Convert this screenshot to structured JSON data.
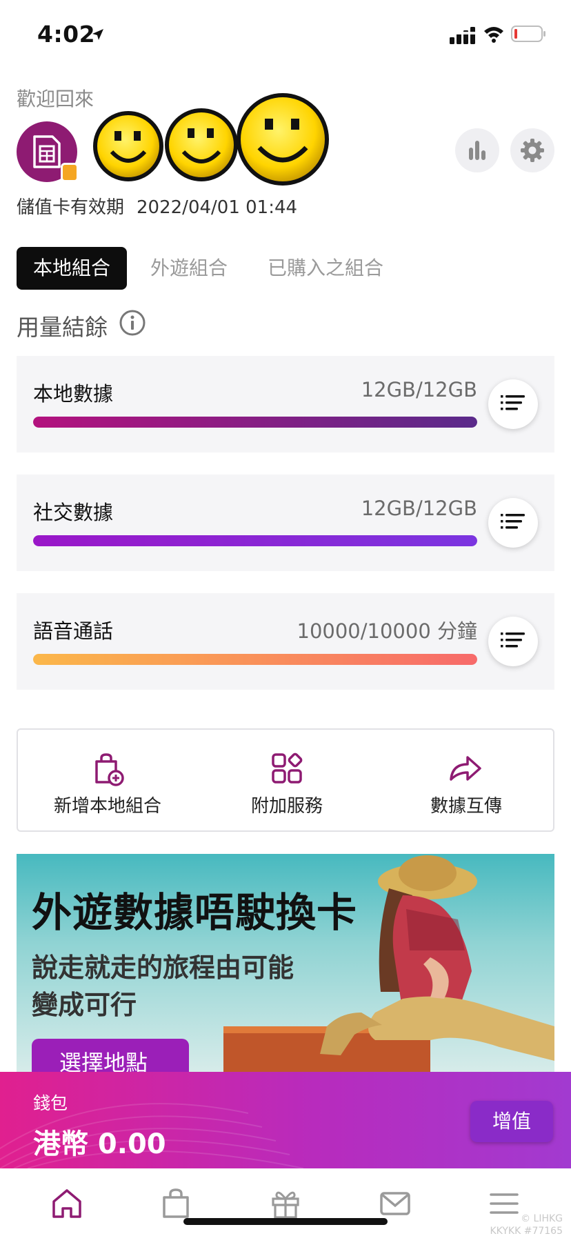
{
  "status_bar": {
    "time": "4:02",
    "icons": [
      "location-arrow-icon",
      "signal-icon",
      "wifi-icon",
      "battery-low-icon"
    ],
    "battery_color": "#e53935"
  },
  "header": {
    "welcome": "歡迎回來",
    "avatar_icon": "sim-card-icon",
    "avatar_color": "#8e1b72",
    "expiry_label": "儲值卡有效期",
    "expiry_value": "2022/04/01 01:44",
    "buttons": [
      "stats-icon",
      "gear-icon"
    ]
  },
  "tabs": [
    {
      "label": "本地組合",
      "active": true
    },
    {
      "label": "外遊組合",
      "active": false
    },
    {
      "label": "已購入之組合",
      "active": false
    }
  ],
  "usage_section": {
    "title": "用量結餘",
    "items": [
      {
        "name": "本地數據",
        "value": "12GB/12GB",
        "fraction": 1.0,
        "gradient": [
          "#b3127e",
          "#5a2a8a"
        ]
      },
      {
        "name": "社交數據",
        "value": "12GB/12GB",
        "fraction": 1.0,
        "gradient": [
          "#9a17c8",
          "#7b35e0"
        ]
      },
      {
        "name": "語音通話",
        "value": "10000/10000 分鐘",
        "fraction": 1.0,
        "gradient": [
          "#fbb74a",
          "#f76a6a"
        ]
      }
    ]
  },
  "quick_actions": [
    {
      "label": "新增本地組合",
      "icon": "add-bag-icon"
    },
    {
      "label": "附加服務",
      "icon": "apps-grid-icon"
    },
    {
      "label": "數據互傳",
      "icon": "share-arrow-icon"
    }
  ],
  "banner": {
    "title": "外遊數據唔駛換卡",
    "subtitle_line1": "說走就走的旅程由可能",
    "subtitle_line2": "變成可行",
    "cta": "選擇地點"
  },
  "wallet": {
    "label": "錢包",
    "balance": "港幣 0.00",
    "topup": "增值"
  },
  "bottom_nav": [
    "home-icon",
    "shopping-bag-icon",
    "gift-icon",
    "mail-icon",
    "menu-icon"
  ],
  "accent_color": "#8e1b72",
  "watermark": {
    "line1": "© LIHKG",
    "line2": "KKYKK #77165"
  }
}
